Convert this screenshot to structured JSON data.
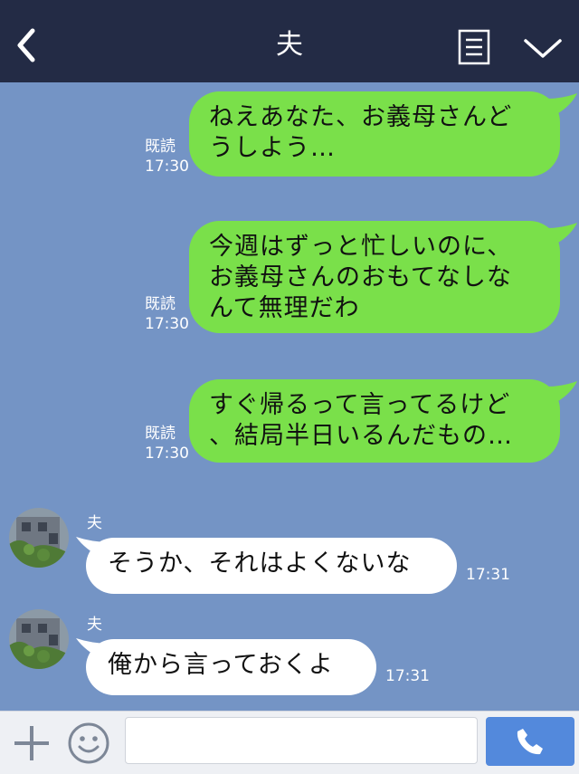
{
  "header": {
    "title": "夫"
  },
  "messages_out": [
    {
      "text": "ねえあなた、お義母さんど\nうしよう…",
      "read": "既読",
      "time": "17:30"
    },
    {
      "text": "今週はずっと忙しいのに、\nお義母さんのおもてなしな\nんて無理だわ",
      "read": "既読",
      "time": "17:30"
    },
    {
      "text": "すぐ帰るって言ってるけど\n、結局半日いるんだもの…",
      "read": "既読",
      "time": "17:30"
    }
  ],
  "messages_in": [
    {
      "sender": "夫",
      "text": "そうか、それはよくないな",
      "time": "17:31"
    },
    {
      "sender": "夫",
      "text": "俺から言っておくよ",
      "time": "17:31"
    }
  ],
  "colors": {
    "header": "#232b45",
    "chat_bg": "#7494c5",
    "bubble_out": "#7ae04a",
    "bubble_in": "#ffffff",
    "call_button": "#5389dc"
  },
  "icons": [
    "back-icon",
    "list-icon",
    "chevron-down-icon",
    "plus-icon",
    "emoji-icon",
    "phone-icon"
  ]
}
